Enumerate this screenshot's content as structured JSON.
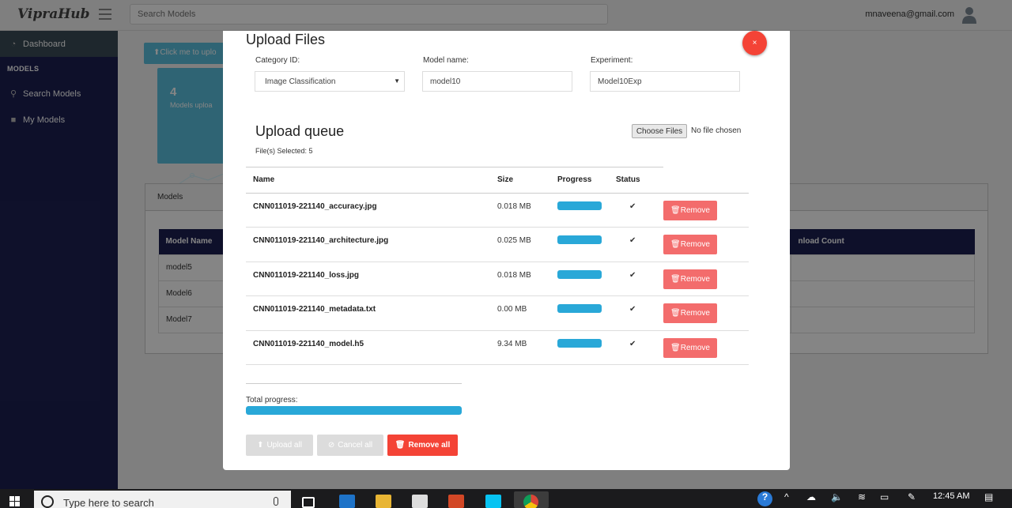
{
  "app": {
    "brand": "VipraHub",
    "search_placeholder": "Search Models",
    "user_email": "mnaveena@gmail.com"
  },
  "sidebar": {
    "dashboard": "Dashboard",
    "heading": "MODELS",
    "search_models": "Search Models",
    "my_models": "My Models"
  },
  "background_page": {
    "upload_button": "Click me to uplo",
    "stat_number": "4",
    "stat_label": "Models uploa",
    "panel_title": "Models",
    "table_headers": [
      "Model Name",
      "nload Count"
    ],
    "rows": [
      "model5",
      "Model6",
      "Model7"
    ]
  },
  "modal": {
    "title": "Upload Files",
    "close_label": "×",
    "category_label": "Category ID:",
    "category_value": "Image Classification",
    "model_name_label": "Model name:",
    "model_name_value": "model10",
    "experiment_label": "Experiment:",
    "experiment_value": "Model10Exp",
    "queue_title": "Upload queue",
    "files_selected": "File(s) Selected: 5",
    "choose_files": "Choose Files",
    "no_file": "No file chosen",
    "columns": {
      "name": "Name",
      "size": "Size",
      "progress": "Progress",
      "status": "Status"
    },
    "files": [
      {
        "name": "CNN011019-221140_accuracy.jpg",
        "size": "0.018 MB",
        "progress": 100,
        "status": "✔",
        "action": "Remove"
      },
      {
        "name": "CNN011019-221140_architecture.jpg",
        "size": "0.025 MB",
        "progress": 100,
        "status": "✔",
        "action": "Remove"
      },
      {
        "name": "CNN011019-221140_loss.jpg",
        "size": "0.018 MB",
        "progress": 100,
        "status": "✔",
        "action": "Remove"
      },
      {
        "name": "CNN011019-221140_metadata.txt",
        "size": "0.00 MB",
        "progress": 100,
        "status": "✔",
        "action": "Remove"
      },
      {
        "name": "CNN011019-221140_model.h5",
        "size": "9.34 MB",
        "progress": 100,
        "status": "✔",
        "action": "Remove"
      }
    ],
    "total_progress_label": "Total progress:",
    "total_progress": 100,
    "upload_all": "Upload all",
    "cancel_all": "Cancel all",
    "remove_all": "Remove all"
  },
  "taskbar": {
    "search_text": "Type here to search",
    "time": "12:45 AM"
  }
}
